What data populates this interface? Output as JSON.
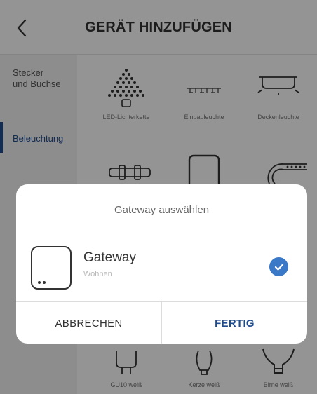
{
  "header": {
    "title": "GERÄT HINZUFÜGEN",
    "back_icon": "chevron-left-icon"
  },
  "sidebar": {
    "items": [
      {
        "label": "Stecker\nund Buchse",
        "active": false
      },
      {
        "label": "Beleuchtung",
        "active": true
      }
    ],
    "accent_color": "#1f4c8f"
  },
  "devices": {
    "row1": [
      {
        "label": "LED-Lichterkette",
        "icon": "led-string-icon"
      },
      {
        "label": "Einbauleuchte",
        "icon": "recessed-light-icon"
      },
      {
        "label": "Deckenleuchte",
        "icon": "ceiling-light-icon"
      }
    ],
    "row2": [
      {
        "icon": "light-strip-icon"
      },
      {
        "icon": "panel-light-icon"
      },
      {
        "icon": "ring-light-icon"
      }
    ],
    "row3": [
      {
        "label": "GU10 weiß",
        "icon": "gu10-bulb-icon"
      },
      {
        "label": "Kerze weiß",
        "icon": "candle-bulb-icon"
      },
      {
        "label": "Birne weiß",
        "icon": "pear-bulb-icon"
      }
    ]
  },
  "dialog": {
    "title": "Gateway auswählen",
    "gateway": {
      "name": "Gateway",
      "room": "Wohnen",
      "selected": true,
      "icon": "gateway-device-icon",
      "check_icon": "checkmark-icon",
      "check_color": "#3a78c8"
    },
    "cancel_label": "ABBRECHEN",
    "done_label": "FERTIG"
  }
}
